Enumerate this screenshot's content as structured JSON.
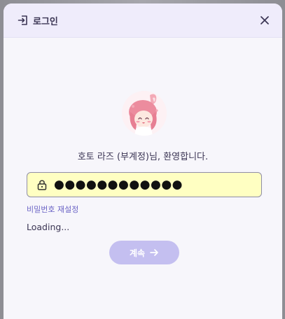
{
  "dialog": {
    "title": "로그인",
    "icon": "login-icon",
    "close_icon": "close-icon"
  },
  "profile": {
    "welcome_text": "호토 라즈 (부계정)님, 환영합니다.",
    "avatar_icon": "avatar"
  },
  "password_field": {
    "value": "●●●●●●●●●●●●",
    "icon": "lock-icon"
  },
  "reset_link": "비밀번호 재설정",
  "status_text": "Loading...",
  "continue_button": {
    "label": "계속",
    "icon": "arrow-right-icon"
  },
  "colors": {
    "accent": "#c4bff0",
    "link": "#6d66c6",
    "field_bg": "#ffffc2"
  }
}
